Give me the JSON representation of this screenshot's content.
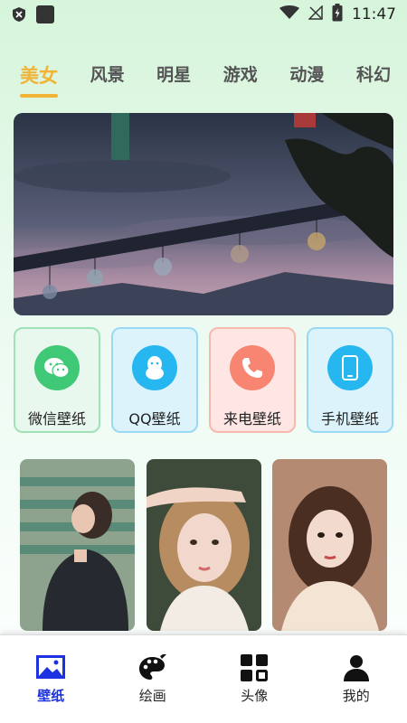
{
  "status": {
    "time": "11:47"
  },
  "tabs": [
    {
      "label": "美女",
      "active": true
    },
    {
      "label": "风景",
      "active": false
    },
    {
      "label": "明星",
      "active": false
    },
    {
      "label": "游戏",
      "active": false
    },
    {
      "label": "动漫",
      "active": false
    },
    {
      "label": "科幻",
      "active": false
    }
  ],
  "categories": [
    {
      "label": "微信壁纸",
      "icon": "wechat-icon"
    },
    {
      "label": "QQ壁纸",
      "icon": "qq-penguin-icon"
    },
    {
      "label": "来电壁纸",
      "icon": "phone-call-icon"
    },
    {
      "label": "手机壁纸",
      "icon": "smartphone-icon"
    }
  ],
  "nav": [
    {
      "label": "壁纸",
      "icon": "image-icon",
      "active": true
    },
    {
      "label": "绘画",
      "icon": "palette-icon",
      "active": false
    },
    {
      "label": "头像",
      "icon": "grid-icon",
      "active": false
    },
    {
      "label": "我的",
      "icon": "user-icon",
      "active": false
    }
  ],
  "colors": {
    "accent": "#f2b437",
    "nav_active": "#1c31e0",
    "bg_top": "#d6f5da"
  }
}
